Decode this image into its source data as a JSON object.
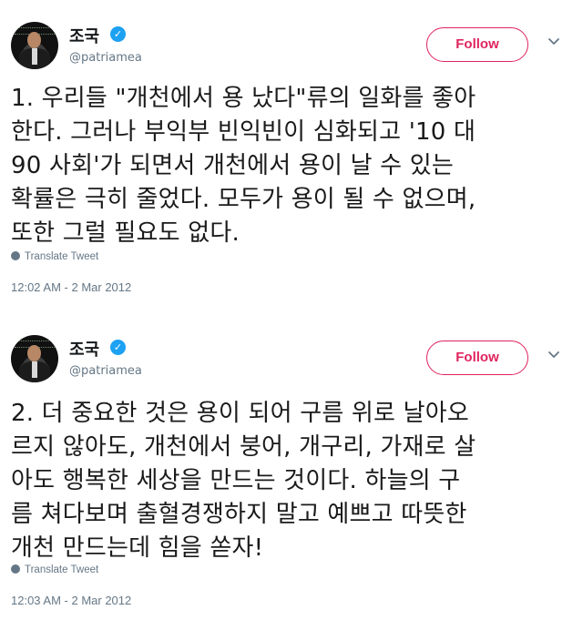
{
  "tweets": [
    {
      "user": {
        "name": "조국",
        "handle": "@patriamea",
        "verified_icon": "verified-badge-icon",
        "accent": "#1da1f2"
      },
      "follow_label": "Follow",
      "follow_color": "#e0245e",
      "lines": [
        "1. 우리들 \"개천에서 용 났다\"류의 일화를 좋아",
        "한다. 그러나 부익부 빈익빈이 심화되고 '10 대",
        "90 사회'가 되면서 개천에서 용이 날 수 있는",
        "확률은 극히 줄었다. 모두가 용이 될 수 없으며,",
        "또한 그럴 필요도 없다."
      ],
      "translate_label": "Translate Tweet",
      "timestamp": "12:02 AM - 2 Mar 2012"
    },
    {
      "user": {
        "name": "조국",
        "handle": "@patriamea",
        "verified_icon": "verified-badge-icon",
        "accent": "#1da1f2"
      },
      "follow_label": "Follow",
      "follow_color": "#e0245e",
      "lines": [
        "2. 더 중요한 것은 용이 되어 구름 위로 날아오",
        "르지 않아도, 개천에서 붕어, 개구리, 가재로 살",
        "아도 행복한 세상을 만드는 것이다. 하늘의 구",
        "름 쳐다보며 출혈경쟁하지 말고 예쁘고 따뜻한",
        "개천 만드는데 힘을 쏟자!"
      ],
      "translate_label": "Translate Tweet",
      "timestamp": "12:03 AM - 2 Mar 2012"
    }
  ]
}
